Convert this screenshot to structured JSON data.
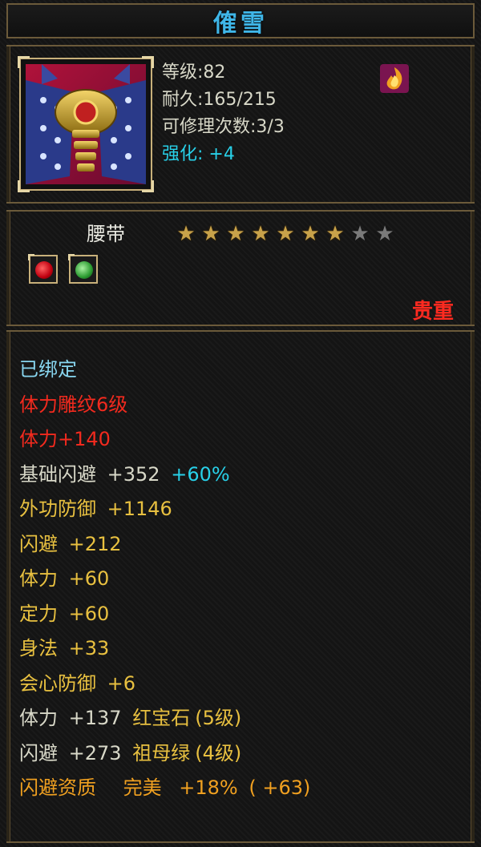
{
  "title": "傕雪",
  "item": {
    "level": "等级:82",
    "durability": "耐久:165/215",
    "repair": "可修理次数:3/3",
    "enhance_label": "强化:",
    "enhance_value": "+4",
    "type": "腰带",
    "stars_total": 9,
    "stars_lit": 7,
    "rarity": "贵重",
    "gems": [
      "red-gem-icon",
      "green-gem-icon"
    ]
  },
  "stats": {
    "bound": "已绑定",
    "carving": "体力雕纹6级",
    "carving_bonus": "体力+140",
    "base_dodge": {
      "label": "基础闪避",
      "value": "+352",
      "pct": "+60%"
    },
    "outer_def": {
      "label": "外功防御",
      "value": "+1146"
    },
    "dodge": {
      "label": "闪避",
      "value": "+212"
    },
    "stamina": {
      "label": "体力",
      "value": "+60"
    },
    "focus": {
      "label": "定力",
      "value": "+60"
    },
    "agility": {
      "label": "身法",
      "value": "+33"
    },
    "crit_def": {
      "label": "会心防御",
      "value": "+6"
    },
    "gem1": {
      "label": "体力",
      "value": "+137",
      "gem": "红宝石",
      "lvl": "(5级)"
    },
    "gem2": {
      "label": "闪避",
      "value": "+273",
      "gem": "祖母绿",
      "lvl": "(4级)"
    },
    "quality": {
      "label": "闪避资质",
      "grade": "完美",
      "value": "+18%",
      "extra": "( +63)"
    }
  },
  "colors": {
    "title": "#3fb6e8",
    "rarity": "#ff2a20",
    "red": "#f22a1e",
    "gold": "#e8c040",
    "cyan": "#28d0e8"
  }
}
